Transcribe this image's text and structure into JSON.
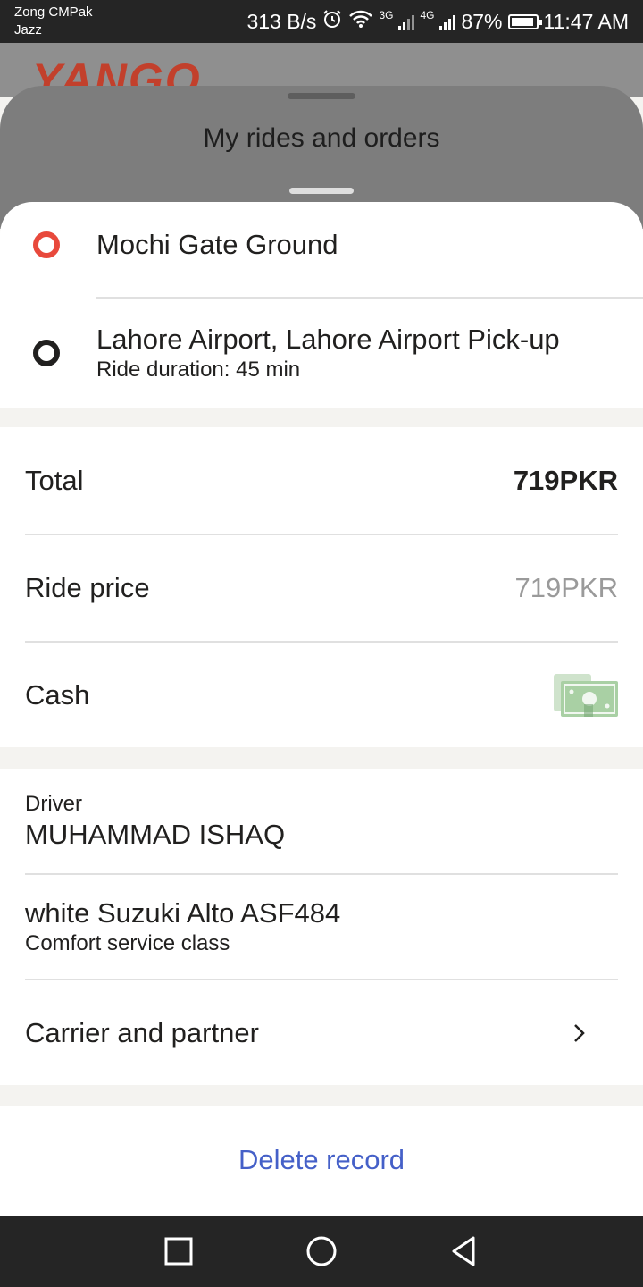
{
  "status_bar": {
    "carrier_line1": "Zong CMPak",
    "carrier_line2": "Jazz",
    "net_speed": "313 B/s",
    "network1": "3G",
    "network2": "4G",
    "battery": "87%",
    "time": "11:47 AM",
    "icons": [
      "alarm-icon",
      "wifi-icon",
      "signal-icon",
      "battery-icon"
    ]
  },
  "background_app": {
    "logo_text": "YANGO"
  },
  "header": {
    "title": "My rides and orders"
  },
  "route": {
    "from": "Mochi Gate Ground",
    "to": "Lahore Airport, Lahore Airport Pick-up",
    "duration": "Ride duration: 45 min",
    "from_color": "#e8493c",
    "to_color": "#21201f"
  },
  "payment": {
    "total_label": "Total",
    "total_value": "719PKR",
    "ride_price_label": "Ride price",
    "ride_price_value": "719PKR",
    "method_label": "Cash",
    "method_icon": "cash-icon"
  },
  "driver": {
    "label": "Driver",
    "name": "MUHAMMAD ISHAQ",
    "car": "white Suzuki Alto ASF484",
    "service_class": "Comfort service class",
    "carrier_label": "Carrier and partner"
  },
  "actions": {
    "delete_label": "Delete record",
    "accent": "#4560c8"
  },
  "nav": {
    "icons": [
      "recent-apps-icon",
      "home-icon",
      "back-icon"
    ]
  }
}
